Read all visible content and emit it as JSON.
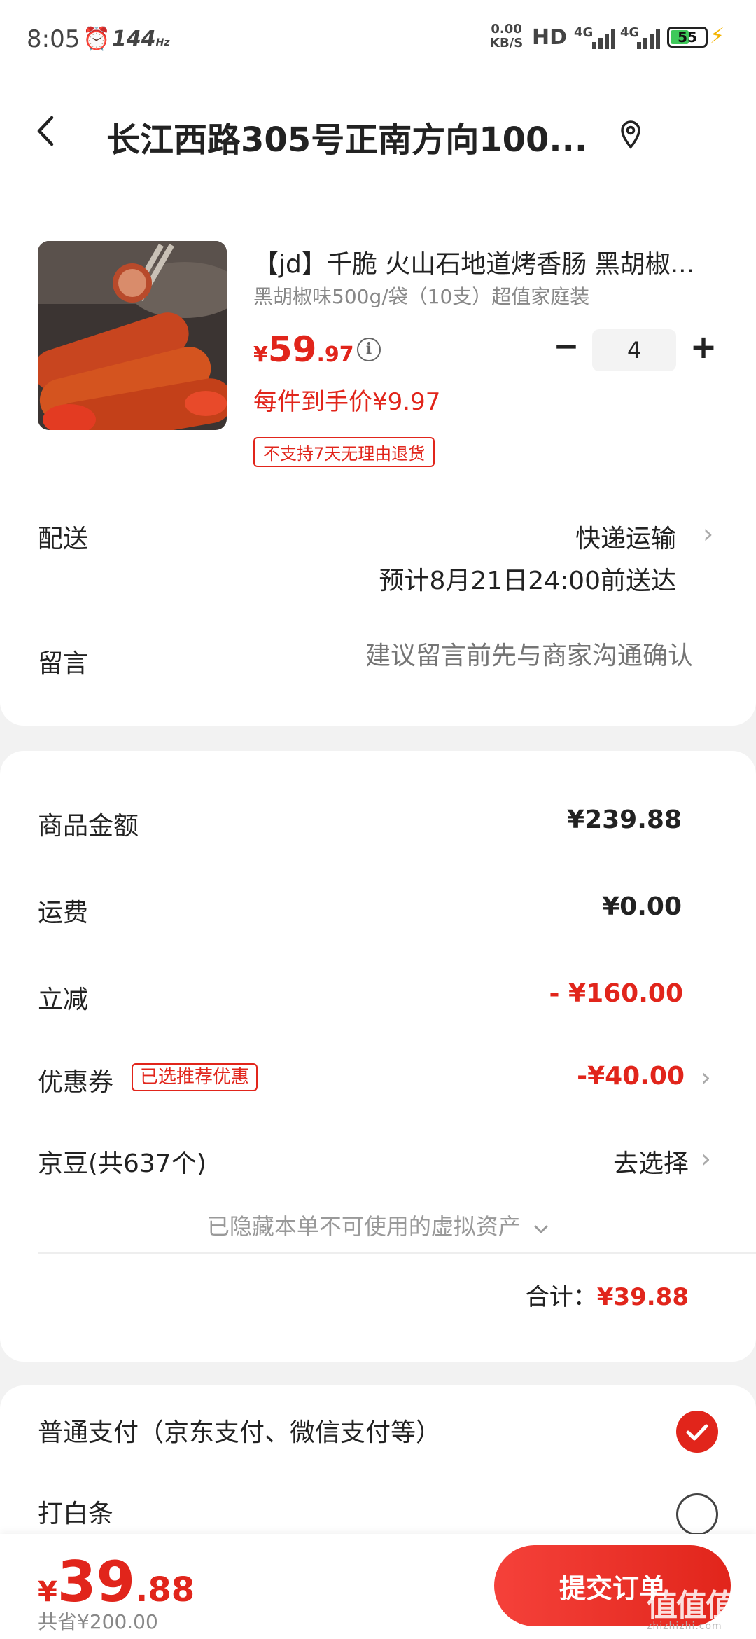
{
  "status_bar": {
    "time": "8:05",
    "refresh_rate": "144",
    "refresh_unit": "Hz",
    "net_speed_value": "0.00",
    "net_speed_unit": "KB/S",
    "hd": "HD",
    "signal1": "4G",
    "signal2": "4G",
    "battery": "55",
    "battery_level": 0.55
  },
  "header": {
    "address": "长江西路305号正南方向100..."
  },
  "product": {
    "title": "【jd】千脆 火山石地道烤香肠 黑胡椒...",
    "spec": "黑胡椒味500g/袋（10支）超值家庭装",
    "price_currency": "¥",
    "price_int": "59",
    "price_dec": ".97",
    "quantity": "4",
    "per_item_price": "每件到手价¥9.97",
    "no_return_tag": "不支持7天无理由退货"
  },
  "shipping": {
    "label": "配送",
    "method": "快递运输",
    "eta": "预计8月21日24:00前送达"
  },
  "message": {
    "label": "留言",
    "placeholder": "建议留言前先与商家沟通确认"
  },
  "summary": {
    "goods_label": "商品金额",
    "goods_value": "¥239.88",
    "freight_label": "运费",
    "freight_value": "¥0.00",
    "discount_label": "立减",
    "discount_value": "- ¥160.00",
    "coupon_label": "优惠券",
    "coupon_tag": "已选推荐优惠",
    "coupon_value": "-¥40.00",
    "beans_label": "京豆(共637个)",
    "beans_action": "去选择",
    "hidden_assets": "已隐藏本单不可使用的虚拟资产",
    "total_label": "合计：",
    "total_value": "¥39.88"
  },
  "payment": {
    "option1": "普通支付（京东支付、微信支付等）",
    "option2": "打白条"
  },
  "bottom_bar": {
    "currency": "¥",
    "int": "39",
    "dec": ".88",
    "saved": "共省¥200.00",
    "submit": "提交订单"
  },
  "watermark": {
    "text": "值值值",
    "sub": "zhizhizhi.com"
  },
  "colors": {
    "accent": "#e1251b",
    "battery_green": "#3ec95a"
  }
}
